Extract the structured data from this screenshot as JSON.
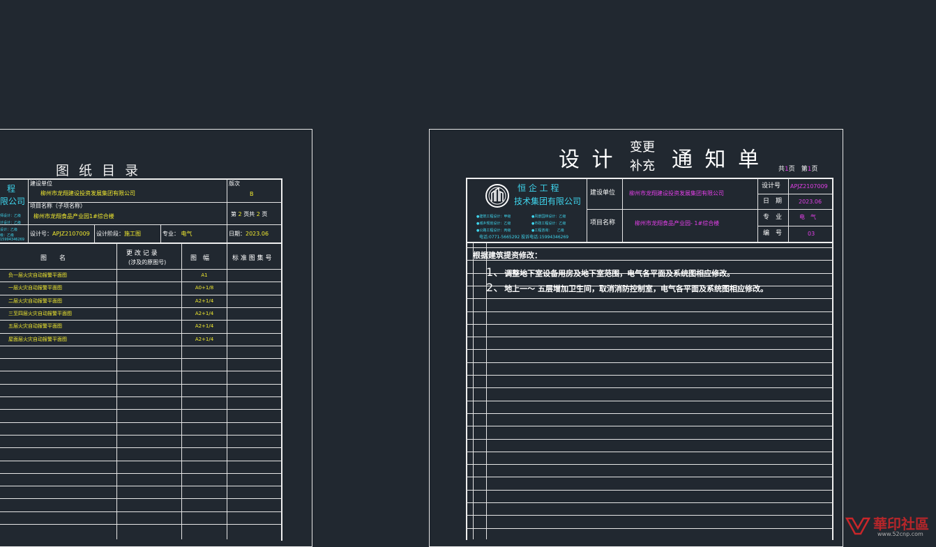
{
  "left_sheet": {
    "title": "图 纸 目 录",
    "company_fragment": {
      "line1": "程",
      "line2": "限公司"
    },
    "company_small": [
      "师设计：乙级",
      "计设计：乙级",
      "设计：乙级",
      "级：乙级"
    ],
    "company_phone": "15994346269",
    "build_unit_label": "建设单位",
    "build_unit_value": "柳州市龙翔建设投资发展集团有限公司",
    "edition_label": "版次",
    "edition_value": "B",
    "project_label": "项目名称（子项名称）",
    "project_value": "柳州市龙翔食品产业园1#综合楼",
    "page_info_pre": "第",
    "page_no": "2",
    "page_info_mid": "页共",
    "page_total": "2",
    "page_info_post": "页",
    "design_no_label": "设计号：",
    "design_no_value": "APJZ2107009",
    "stage_label": "设计阶段：",
    "stage_value": "施工图",
    "major_label": "专业：",
    "major_value": "电气",
    "date_label": "日期：",
    "date_value": "2023.06",
    "col_headers": {
      "name": "图　　名",
      "change": "更 改 记 录",
      "change_sub": "(涉及的原图号)",
      "size": "图　幅",
      "std": "标 准 图 集 号"
    },
    "rows": [
      {
        "name": "负一层火灾自动报警平面图",
        "size": "A1"
      },
      {
        "name": "一层火灾自动报警平面图",
        "size": "A0+1/8"
      },
      {
        "name": "二层火灾自动报警平面图",
        "size": "A2+1/4"
      },
      {
        "name": "三至四层火灾自动报警平面图",
        "size": "A2+1/4"
      },
      {
        "name": "五层火灾自动报警平面图",
        "size": "A2+1/4"
      },
      {
        "name": "屋面层火灾自动报警平面图",
        "size": "A2+1/4"
      }
    ]
  },
  "right_sheet": {
    "title_left": "设 计",
    "title_top": "变更",
    "title_bottom": "补充",
    "title_right": "通 知 单",
    "pages": {
      "pre": "共",
      "total": "1",
      "mid": "页　第",
      "current": "1",
      "post": "页"
    },
    "company_name_1": "恒 企 工 程",
    "company_name_2": "技术集团有限公司",
    "qualifications": [
      "●建筑工程设计：甲级",
      "●风景园林设计：乙级",
      "●城乡规划设计：乙级",
      "●市政工程设计：乙级",
      "●公路工程设计：丙级",
      "●工程咨询：　　乙级"
    ],
    "company_contact": "电话:0771-5665292 投诉电话:15994346269",
    "build_unit_label": "建设单位",
    "build_unit_value": "柳州市龙翔建设投资发展集团有限公司",
    "project_label": "项目名称",
    "project_value": "柳州市龙翔食品产业园- 1#综合楼",
    "design_no_label": "设计号",
    "design_no_value": "APJZ2107009",
    "date_label": "日　期",
    "date_value": "2023.06",
    "major_label": "专　业",
    "major_value": "电　气",
    "serial_label": "编　号",
    "serial_value": "03",
    "content_heading": "根据建筑提资修改：",
    "items": [
      {
        "num": "1、",
        "text": "调整地下室设备用房及地下室范围，电气各平面及系统图相应修改。"
      },
      {
        "num": "2、",
        "text": "地上一～ 五层增加卫生间，取消消防控制室，电气各平面及系统图相应修改。"
      }
    ]
  },
  "watermark": {
    "text": "華印社區",
    "url": "www.52cnp.com"
  },
  "colors": {
    "background": "#212830",
    "line": "#e8e8e8",
    "yellow": "#f2ea2f",
    "cyan": "#3fd6ee",
    "magenta": "#e23fe8",
    "watermark_red": "#c8262a"
  }
}
